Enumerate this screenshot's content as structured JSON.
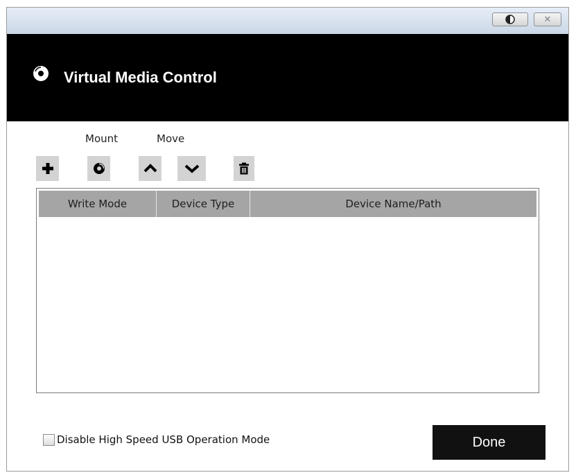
{
  "window": {
    "title": "Virtual Media Control"
  },
  "titlebar": {
    "theme_icon": "contrast-icon",
    "close_glyph": "✕"
  },
  "toolbar": {
    "mount_label": "Mount",
    "move_label": "Move",
    "buttons": [
      {
        "icon": "plus-icon"
      },
      {
        "icon": "disc-icon"
      },
      {
        "icon": "chevron-up-icon"
      },
      {
        "icon": "chevron-down-icon"
      },
      {
        "icon": "trash-icon"
      }
    ]
  },
  "table": {
    "columns": [
      "Write Mode",
      "Device Type",
      "Device Name/Path"
    ],
    "rows": []
  },
  "footer": {
    "usb_checkbox_label": "Disable High Speed USB Operation Mode",
    "usb_checkbox_checked": false,
    "done_label": "Done"
  }
}
